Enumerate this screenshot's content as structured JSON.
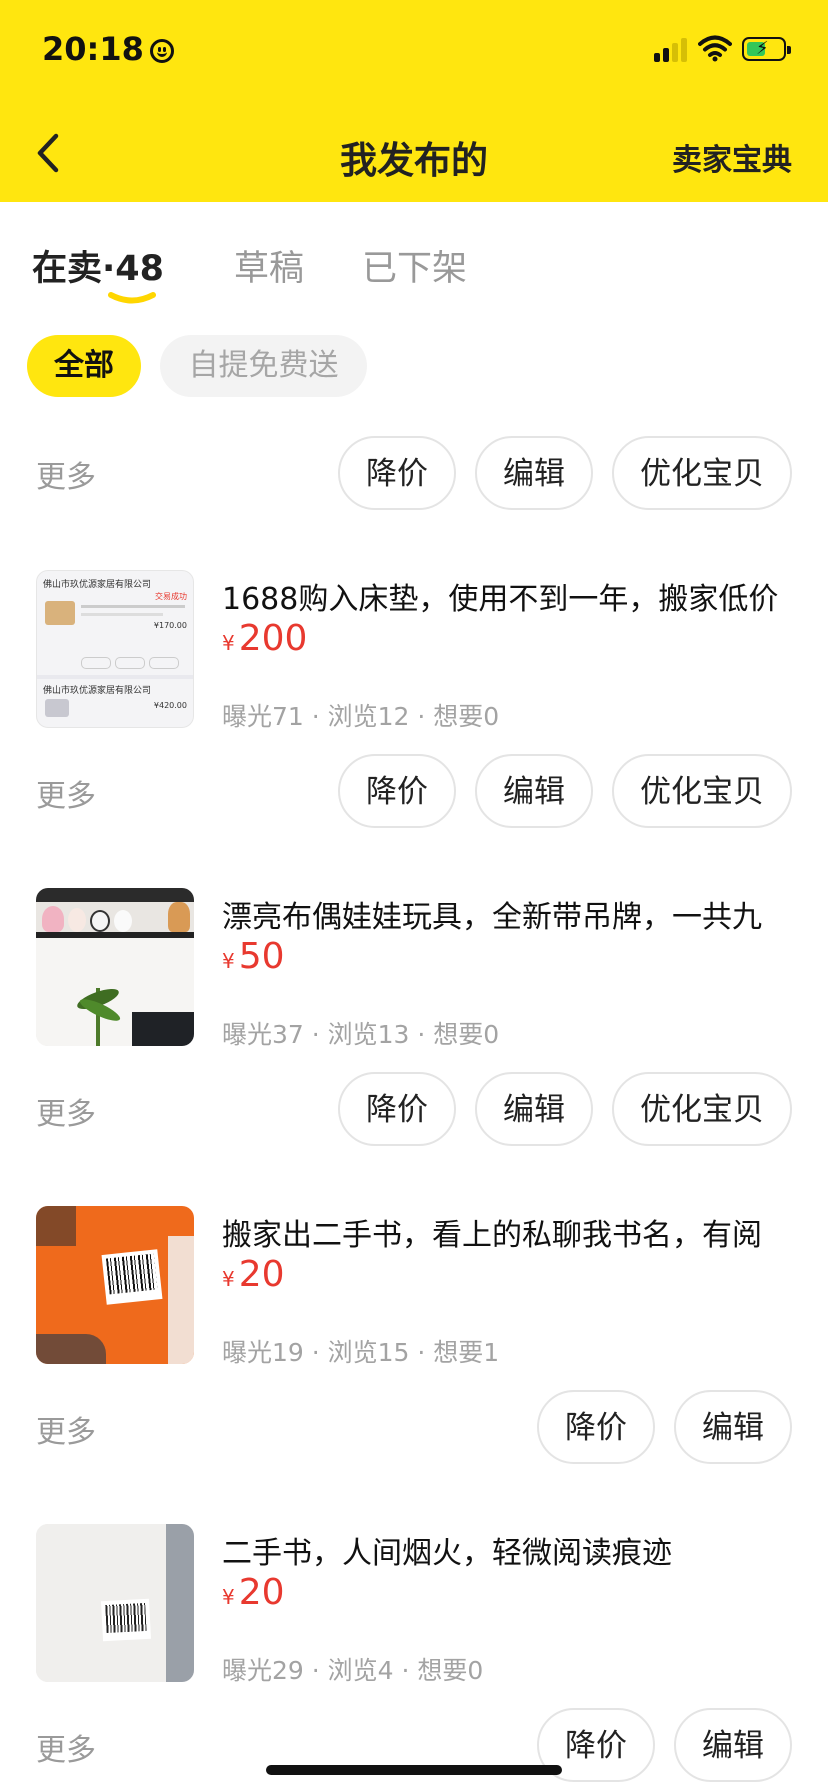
{
  "status_bar": {
    "time": "20:18"
  },
  "nav": {
    "title": "我发布的",
    "right_link": "卖家宝典"
  },
  "tabs": [
    {
      "label": "在卖·48",
      "active": true
    },
    {
      "label": "草稿",
      "active": false
    },
    {
      "label": "已下架",
      "active": false
    }
  ],
  "filters": [
    {
      "label": "全部",
      "active": true
    },
    {
      "label": "自提免费送",
      "active": false
    }
  ],
  "top_actions": {
    "more": "更多",
    "reduce": "降价",
    "edit": "编辑",
    "optimize": "优化宝贝"
  },
  "items": [
    {
      "title": "1688购入床垫，使用不到一年，搬家低价",
      "currency": "¥",
      "price": "200",
      "stats": "曝光71 · 浏览12 · 想要0",
      "more": "更多",
      "actions": [
        "降价",
        "编辑",
        "优化宝贝"
      ],
      "thumb_text": {
        "shop": "佛山市玖优源家居有限公司",
        "status": "交易成功",
        "amount": "¥170.00",
        "amount2": "¥420.00"
      }
    },
    {
      "title": "漂亮布偶娃娃玩具，全新带吊牌，一共九",
      "currency": "¥",
      "price": "50",
      "stats": "曝光37 · 浏览13 · 想要0",
      "more": "更多",
      "actions": [
        "降价",
        "编辑",
        "优化宝贝"
      ]
    },
    {
      "title": "搬家出二手书，看上的私聊我书名，有阅",
      "currency": "¥",
      "price": "20",
      "stats": "曝光19 · 浏览15 · 想要1",
      "more": "更多",
      "actions": [
        "降价",
        "编辑"
      ]
    },
    {
      "title": "二手书，人间烟火，轻微阅读痕迹",
      "currency": "¥",
      "price": "20",
      "stats": "曝光29 · 浏览4 · 想要0",
      "more": "更多",
      "actions": [
        "降价",
        "编辑"
      ]
    }
  ],
  "colors": {
    "brand_yellow": "#FFE60F",
    "price_red": "#E8392F",
    "muted": "#9a9a9a"
  }
}
